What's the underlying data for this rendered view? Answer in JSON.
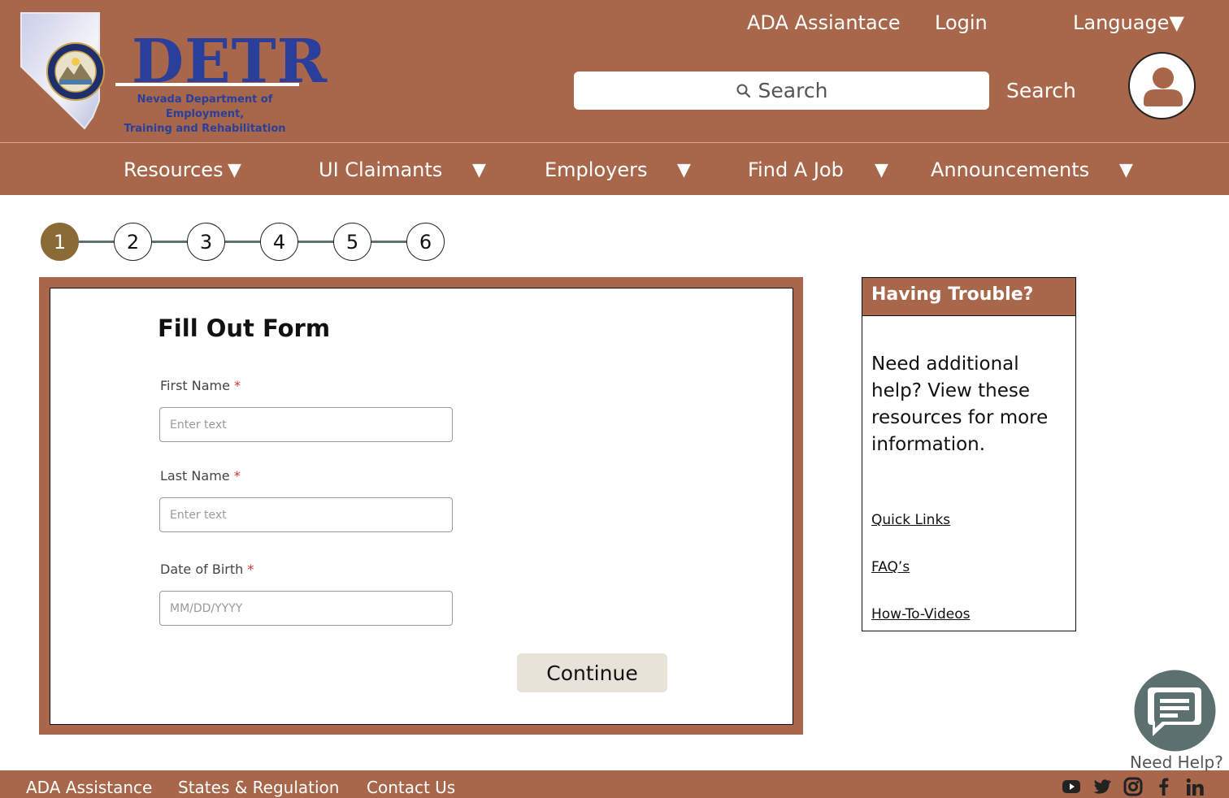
{
  "header": {
    "logo": {
      "name": "DETR",
      "subtitle_line1": "Nevada Department of Employment,",
      "subtitle_line2": "Training and Rehabilitation",
      "seal_text": "THE GREAT SEAL OF THE STATE OF NEVADA"
    },
    "top_links": {
      "ada": "ADA Assiantace",
      "login": "Login",
      "language": "Language▼"
    },
    "search": {
      "placeholder": "Search",
      "button_label": "Search"
    }
  },
  "nav": {
    "items": [
      {
        "label": "Resources",
        "caret": "▼"
      },
      {
        "label": "UI Claimants",
        "caret": "▼"
      },
      {
        "label": "Employers",
        "caret": "▼"
      },
      {
        "label": "Find A Job",
        "caret": "▼"
      },
      {
        "label": "Announcements",
        "caret": "▼"
      }
    ]
  },
  "stepper": {
    "steps": [
      "1",
      "2",
      "3",
      "4",
      "5",
      "6"
    ],
    "current": 1
  },
  "form": {
    "title": "Fill Out Form",
    "required_mark": "*",
    "fields": [
      {
        "label": "First Name",
        "placeholder": "Enter text",
        "value": ""
      },
      {
        "label": "Last Name",
        "placeholder": "Enter text",
        "value": ""
      },
      {
        "label": "Date of Birth",
        "placeholder": "MM/DD/YYYY",
        "value": ""
      }
    ],
    "continue_label": "Continue"
  },
  "help": {
    "title": "Having Trouble?",
    "body": "Need additional help? View these resources for more information.",
    "links": [
      "Quick Links",
      "FAQ’s",
      "How-To-Videos"
    ]
  },
  "chat": {
    "label": "Need Help?",
    "icon": "chat-bubble-icon"
  },
  "footer": {
    "links": [
      "ADA Assistance",
      "States & Regulation",
      "Contact Us"
    ],
    "social": [
      "youtube-icon",
      "twitter-icon",
      "instagram-icon",
      "facebook-icon",
      "linkedin-icon"
    ]
  },
  "colors": {
    "brand": "#a8674b",
    "step_active": "#8b6b35",
    "logo_blue": "#2a3f9a",
    "continue_bg": "#e8e3d9",
    "chat_bg": "#5d7070"
  }
}
